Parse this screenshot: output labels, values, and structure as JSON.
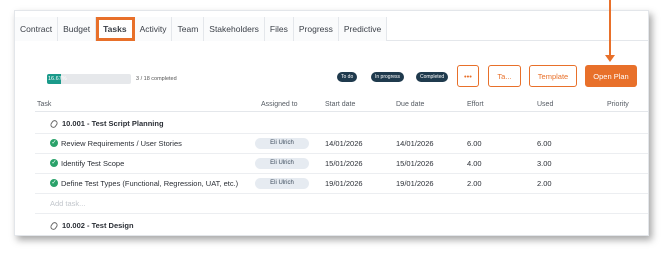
{
  "tabs": [
    {
      "label": "Contract"
    },
    {
      "label": "Budget"
    },
    {
      "label": "Tasks",
      "active": true
    },
    {
      "label": "Activity"
    },
    {
      "label": "Team"
    },
    {
      "label": "Stakeholders"
    },
    {
      "label": "Files"
    },
    {
      "label": "Progress"
    },
    {
      "label": "Predictive"
    }
  ],
  "progress": {
    "percent_label": "16.67%",
    "fraction": 0.1667,
    "completed_text": "3 / 18 completed"
  },
  "status_filters": [
    "To do",
    "In progress",
    "Completed"
  ],
  "buttons": {
    "more": "•••",
    "ta": "Ta...",
    "template": "Template",
    "open_plan": "Open Plan"
  },
  "columns": [
    "Task",
    "Assigned to",
    "Start date",
    "Due date",
    "Effort",
    "Used",
    "Priority"
  ],
  "groups": [
    {
      "title": "10.001 - Test Script Planning",
      "tasks": [
        {
          "name": "Review Requirements / User Stories",
          "assignee": "Eli Ulrich",
          "start": "14/01/2026",
          "due": "14/01/2026",
          "effort": "6.00",
          "used": "6.00"
        },
        {
          "name": "Identify Test Scope",
          "assignee": "Eli Ulrich",
          "start": "15/01/2026",
          "due": "15/01/2026",
          "effort": "4.00",
          "used": "3.00"
        },
        {
          "name": "Define Test Types (Functional, Regression, UAT, etc.)",
          "assignee": "Eli Ulrich",
          "start": "19/01/2026",
          "due": "19/01/2026",
          "effort": "2.00",
          "used": "2.00"
        }
      ],
      "add_placeholder": "Add task..."
    },
    {
      "title": "10.002 - Test Design"
    }
  ],
  "colors": {
    "accent": "#e8702a",
    "progress": "#1a9a8a",
    "pill": "#1f3a4d",
    "check": "#2aa26a"
  }
}
